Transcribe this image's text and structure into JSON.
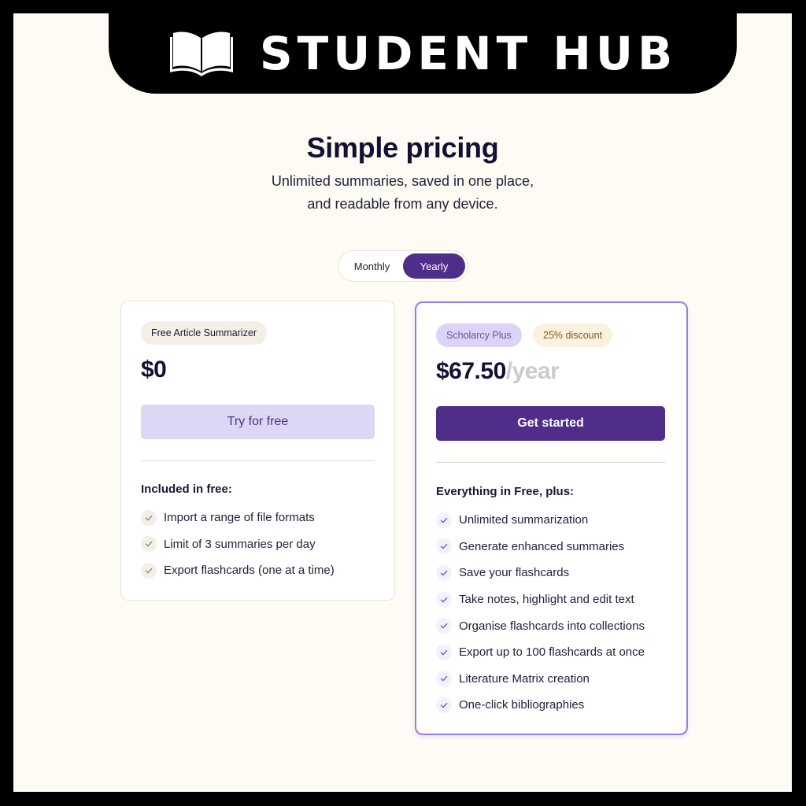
{
  "banner": {
    "title": "STUDENT HUB",
    "icon": "open-book-icon"
  },
  "header": {
    "title": "Simple pricing",
    "subtitle_line1": "Unlimited summaries, saved in one place,",
    "subtitle_line2": "and readable from any device."
  },
  "billing_toggle": {
    "options": [
      "Monthly",
      "Yearly"
    ],
    "selected": "Yearly"
  },
  "plans": {
    "free": {
      "badge": "Free Article Summarizer",
      "price": "$0",
      "cta": "Try for free",
      "list_title": "Included in free:",
      "features": [
        "Import a range of file formats",
        "Limit of 3 summaries per day",
        "Export flashcards (one at a time)"
      ]
    },
    "plus": {
      "badge": "Scholarcy Plus",
      "discount_badge": "25% discount",
      "price": "$67.50",
      "period": "/year",
      "cta": "Get started",
      "list_title": "Everything in Free, plus:",
      "features": [
        "Unlimited summarization",
        "Generate enhanced summaries",
        "Save your flashcards",
        "Take notes, highlight and edit text",
        "Organise flashcards into collections",
        "Export up to 100 flashcards at once",
        "Literature Matrix creation",
        "One-click bibliographies"
      ]
    }
  },
  "colors": {
    "accent": "#4F2E8A",
    "accent_light": "#DDD6F5",
    "plus_border": "#9B7CE6",
    "background": "#FDFBF4",
    "check_neutral": "#8C8A7E",
    "check_purple": "#7A5BD0"
  }
}
